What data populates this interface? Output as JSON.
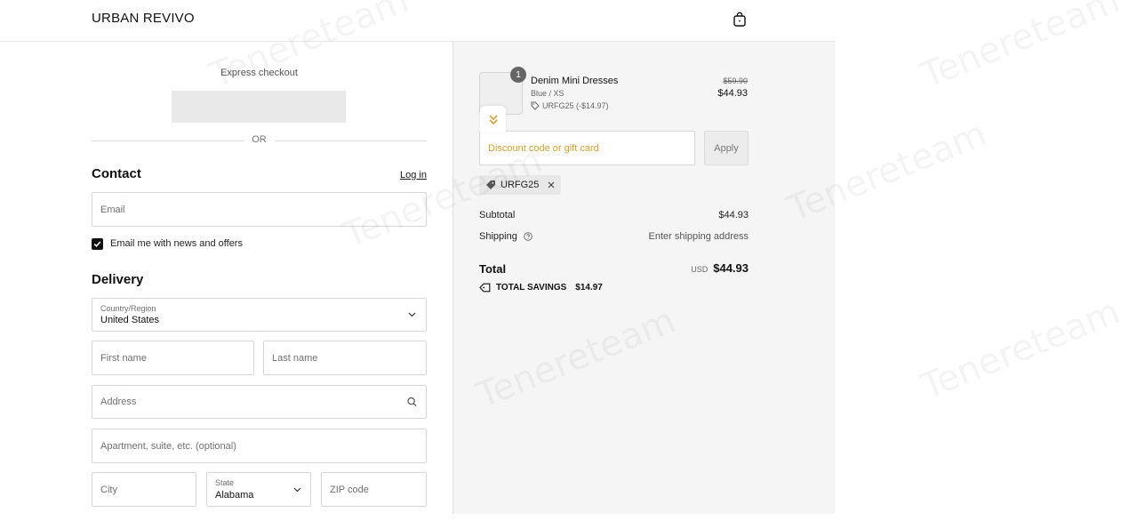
{
  "header": {
    "brand": "URBAN REVIVO",
    "cart_icon": "shopping-bag-icon"
  },
  "express": {
    "label": "Express checkout",
    "divider": "OR"
  },
  "contact": {
    "title": "Contact",
    "login_label": "Log in",
    "email_placeholder": "Email",
    "newsletter_label": "Email me with news and offers",
    "newsletter_checked": true
  },
  "delivery": {
    "title": "Delivery",
    "country_label": "Country/Region",
    "country_value": "United States",
    "first_name_placeholder": "First name",
    "last_name_placeholder": "Last name",
    "address_placeholder": "Address",
    "apartment_placeholder": "Apartment, suite, etc. (optional)",
    "city_placeholder": "City",
    "state_label": "State",
    "state_value": "Alabama",
    "zip_placeholder": "ZIP code"
  },
  "summary": {
    "item": {
      "quantity": "1",
      "name": "Denim Mini Dresses",
      "variant": "Blue / XS",
      "discount": "URFG25 (-$14.97)",
      "price_original": "$59.90",
      "price": "$44.93"
    },
    "discount_placeholder": "Discount code or gift card",
    "apply_label": "Apply",
    "applied_code": "URFG25",
    "subtotal_label": "Subtotal",
    "subtotal_value": "$44.93",
    "shipping_label": "Shipping",
    "shipping_value": "Enter shipping address",
    "total_label": "Total",
    "currency": "USD",
    "total_value": "$44.93",
    "savings_label": "TOTAL SAVINGS",
    "savings_value": "$14.97"
  },
  "watermark": "Tenereteam",
  "colors": {
    "accent": "#e0a020",
    "panel_bg": "#f5f5f5",
    "text": "#111111"
  }
}
